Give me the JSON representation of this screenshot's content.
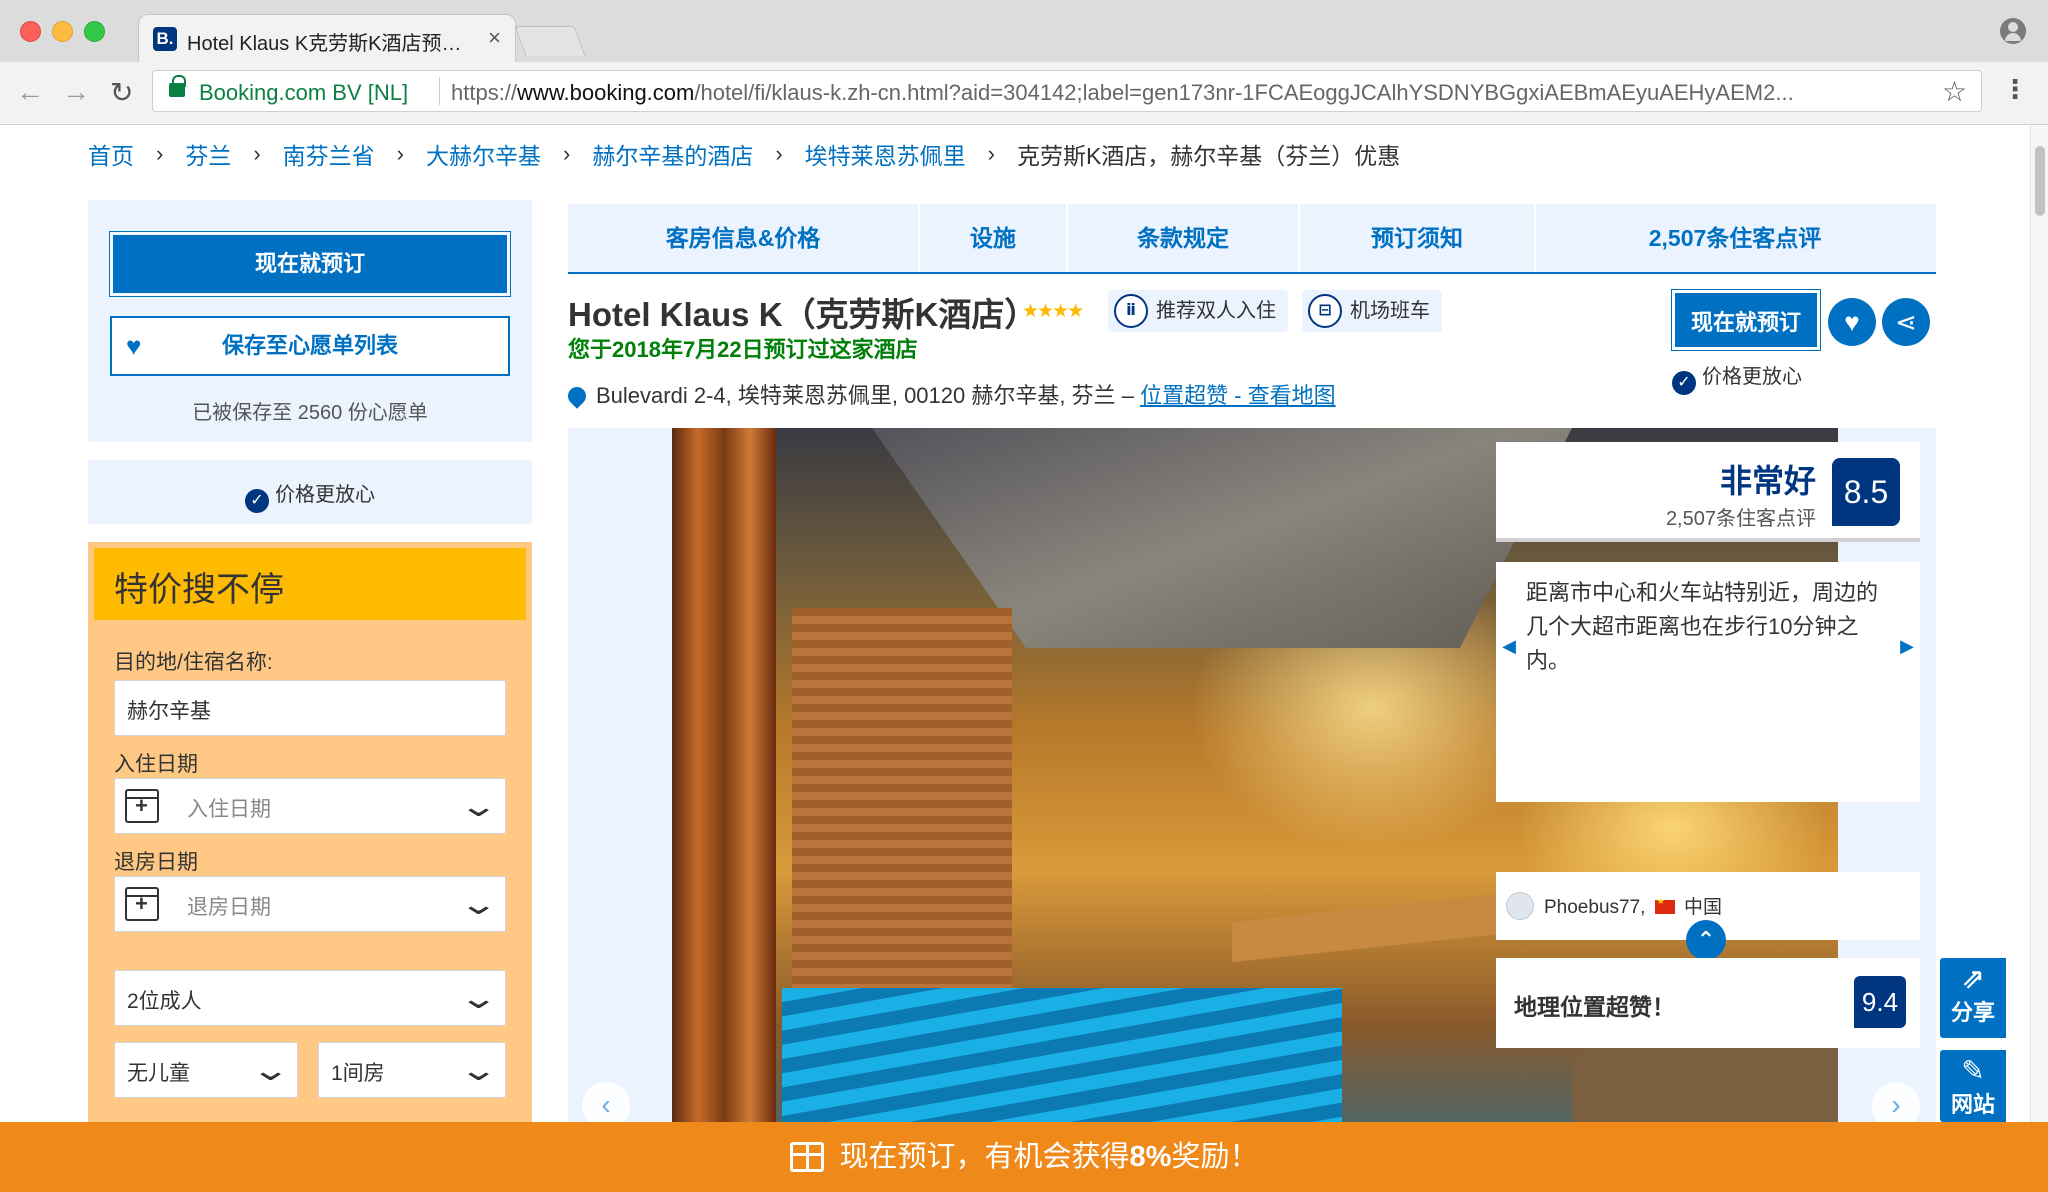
{
  "browser": {
    "tab_title": "Hotel Klaus K克劳斯K酒店预订_",
    "tab_favicon": "B.",
    "secure_name": "Booking.com BV [NL]",
    "url_scheme": "https://",
    "url_host": "www.booking.com",
    "url_path": "/hotel/fi/klaus-k.zh-cn.html?aid=304142;label=gen173nr-1FCAEoggJCAlhYSDNYBGgxiAEBmAEyuAEHyAEM2..."
  },
  "breadcrumb": {
    "items": [
      "首页",
      "芬兰",
      "南芬兰省",
      "大赫尔辛基",
      "赫尔辛基的酒店",
      "埃特莱恩苏佩里"
    ],
    "current": "克劳斯K酒店，赫尔辛基（芬兰）优惠"
  },
  "sidebar": {
    "book_now": "现在就预订",
    "wishlist": "保存至心愿单列表",
    "saved_count": "已被保存至 2560 份心愿单",
    "price_assurance": "价格更放心"
  },
  "search": {
    "title": "特价搜不停",
    "destination_label": "目的地/住宿名称:",
    "destination_value": "赫尔辛基",
    "checkin_label": "入住日期",
    "checkin_placeholder": "入住日期",
    "checkout_label": "退房日期",
    "checkout_placeholder": "退房日期",
    "adults": "2位成人",
    "children": "无儿童",
    "rooms": "1间房"
  },
  "tabs": [
    "客房信息&价格",
    "设施",
    "条款规定",
    "预订须知",
    "2,507条住客点评"
  ],
  "hotel": {
    "name": "Hotel Klaus K（克劳斯K酒店）",
    "stars": "★★★★",
    "pill_couple": "推荐双人入住",
    "pill_shuttle": "机场班车",
    "booked_note": "您于2018年7月22日预订过这家酒店",
    "address": "Bulevardi 2-4, 埃特莱恩苏佩里, 00120 赫尔辛基, 芬兰 –",
    "map_link": "位置超赞 - 查看地图",
    "book_now": "现在就预订",
    "price_assurance": "价格更放心"
  },
  "review": {
    "score_word": "非常好",
    "score_count": "2,507条住客点评",
    "score": "8.5",
    "text": "距离市中心和火车站特别近，周边的几个大超市距离也在步行10分钟之内。",
    "reviewer": "Phoebus77,",
    "reviewer_country": "中国",
    "location_text": "地理位置超赞！",
    "location_score": "9.4"
  },
  "float": {
    "share": "分享",
    "site": "网站"
  },
  "promo": {
    "prefix": "现在预订，有机会获得",
    "percent": "8%",
    "suffix": "奖励！"
  },
  "colors": {
    "brand_blue": "#0071c2",
    "navy": "#003580",
    "promo_orange": "#ef8a1a",
    "search_yellow": "#febb02",
    "success_green": "#008009"
  }
}
